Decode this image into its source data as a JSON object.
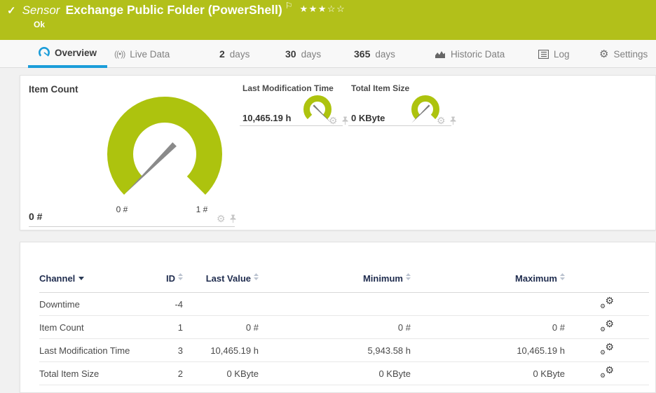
{
  "header": {
    "check": "✓",
    "kind": "Sensor",
    "title": "Exchange Public Folder (PowerShell)",
    "flag": "⚐",
    "stars": "★★★☆☆",
    "status": "Ok"
  },
  "tabs": {
    "overview": "Overview",
    "live_data": "Live Data",
    "d2_num": "2",
    "d2_label": "days",
    "d30_num": "30",
    "d30_label": "days",
    "d365_num": "365",
    "d365_label": "days",
    "historic": "Historic Data",
    "log": "Log",
    "settings": "Settings"
  },
  "icons": {
    "live": "((•))",
    "gear": "⚙"
  },
  "colors": {
    "status_ok_green": "#b2c01a",
    "gauge_green": "#adc30e",
    "active_tab_blue": "#1b9dd9"
  },
  "gauges": {
    "item_count": {
      "title": "Item Count",
      "value": "0 #",
      "scale_min": "0 #",
      "scale_max": "1 #",
      "min": 0,
      "max": 1,
      "current": 0
    },
    "last_modification_time": {
      "title": "Last Modification Time",
      "value": "10,465.19 h"
    },
    "total_item_size": {
      "title": "Total Item Size",
      "value": "0 KByte"
    }
  },
  "table": {
    "headers": {
      "channel": "Channel",
      "id": "ID",
      "last_value": "Last Value",
      "minimum": "Minimum",
      "maximum": "Maximum"
    },
    "rows": [
      {
        "channel": "Downtime",
        "id": "-4",
        "last_value": "",
        "minimum": "",
        "maximum": ""
      },
      {
        "channel": "Item Count",
        "id": "1",
        "last_value": "0 #",
        "minimum": "0 #",
        "maximum": "0 #"
      },
      {
        "channel": "Last Modification Time",
        "id": "3",
        "last_value": "10,465.19 h",
        "minimum": "5,943.58 h",
        "maximum": "10,465.19 h"
      },
      {
        "channel": "Total Item Size",
        "id": "2",
        "last_value": "0 KByte",
        "minimum": "0 KByte",
        "maximum": "0 KByte"
      }
    ]
  }
}
